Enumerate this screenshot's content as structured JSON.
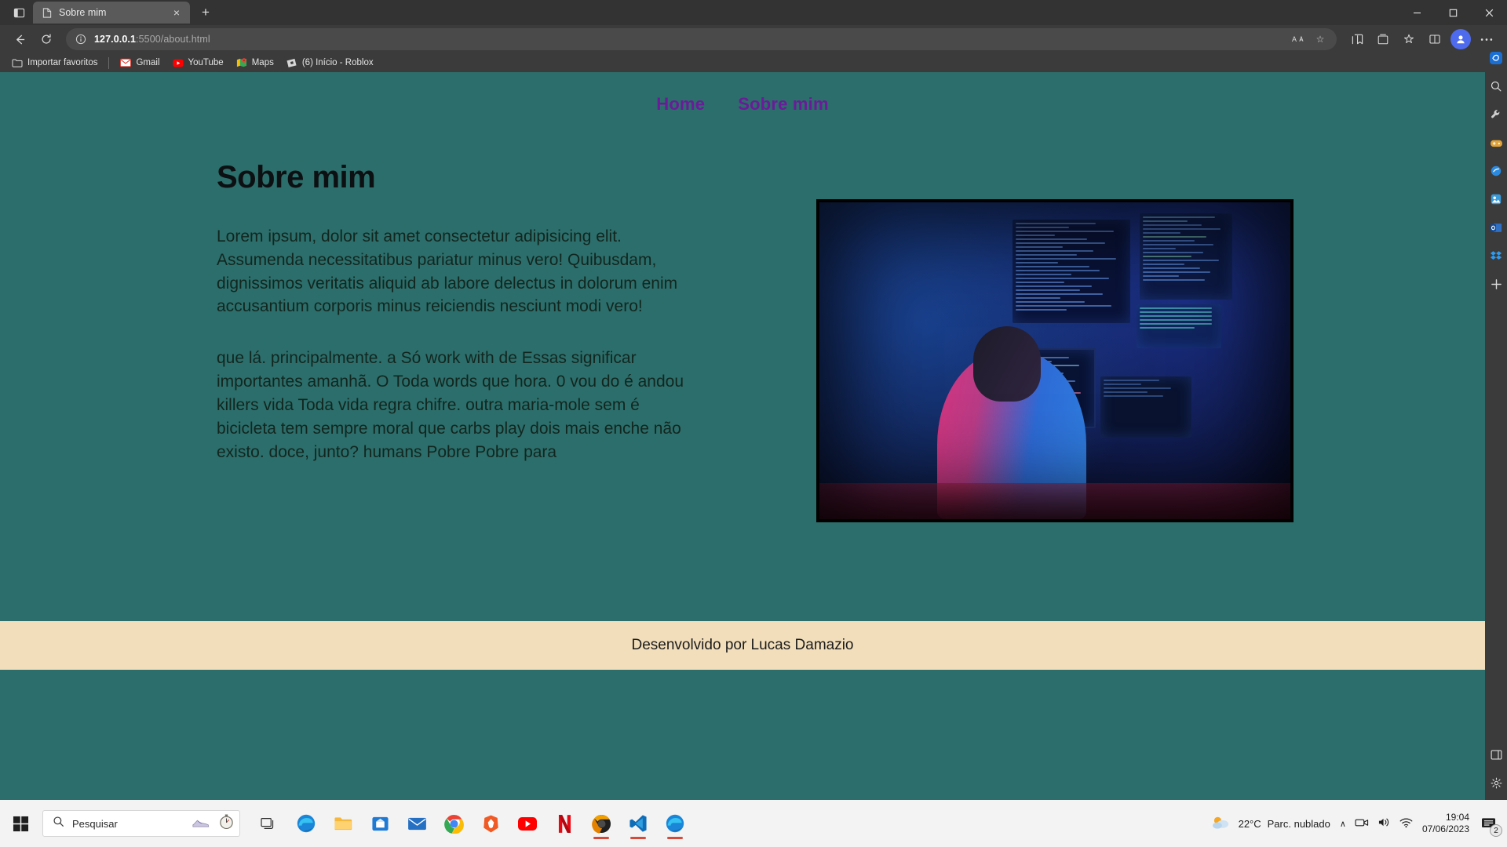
{
  "browser": {
    "tab": {
      "title": "Sobre mim",
      "favicon": "page-icon",
      "close": "×"
    },
    "new_tab_label": "+",
    "window_controls": {
      "minimize": "—",
      "maximize": "☐",
      "close": "✕"
    },
    "nav": {
      "back": "←",
      "forward": "→",
      "refresh": "↻"
    },
    "omnibox": {
      "host": "127.0.0.1",
      "rest": ":5500/about.html",
      "info_icon": "info-icon",
      "read_aloud": "A",
      "favorite": "☆"
    },
    "toolbar_icons": [
      "collections-icon",
      "favorites-icon",
      "browser-essentials-icon",
      "split-screen-icon",
      "settings-more-icon"
    ],
    "profile_initial": "●",
    "bookmarks": [
      {
        "label": "Importar favoritos",
        "icon": "folder-import-icon"
      },
      {
        "label": "Gmail",
        "icon": "gmail-icon"
      },
      {
        "label": "YouTube",
        "icon": "youtube-icon"
      },
      {
        "label": "Maps",
        "icon": "maps-icon"
      },
      {
        "label": "(6) Início - Roblox",
        "icon": "roblox-icon"
      }
    ],
    "sidebar_icons": [
      "copilot-icon",
      "search-icon",
      "tools-icon",
      "games-icon",
      "shopping-icon",
      "designer-icon",
      "outlook-icon",
      "dropbox-icon",
      "add-icon",
      "sidebar-customize-icon",
      "sidebar-settings-icon"
    ]
  },
  "page": {
    "nav_links": [
      {
        "label": "Home"
      },
      {
        "label": "Sobre mim"
      }
    ],
    "heading": "Sobre mim",
    "paragraph1": "Lorem ipsum, dolor sit amet consectetur adipisicing elit. Assumenda necessitatibus pariatur minus vero! Quibusdam, dignissimos veritatis aliquid ab labore delectus in dolorum enim accusantium corporis minus reiciendis nesciunt modi vero!",
    "paragraph2": "que lá. principalmente. a Só work with de Essas significar importantes amanhã. O Toda words que hora. 0 vou do é andou killers vida Toda vida regra chifre. outra maria-mole sem é bicicleta tem sempre moral que carbs play dois mais enche não existo. doce, junto? humans Pobre Pobre para",
    "image_alt": "developer-at-monitors-photo",
    "footer_text": "Desenvolvido por Lucas Damazio",
    "colors": {
      "background": "#2c6e6b",
      "link": "#6b1b9a",
      "heading": "#0d1012",
      "body_text": "#12261f",
      "footer_background": "#f2debb"
    }
  },
  "taskbar": {
    "start_icon": "windows-start-icon",
    "search": {
      "placeholder": "Pesquisar",
      "icon": "search-icon"
    },
    "apps": [
      {
        "name": "task-view-icon"
      },
      {
        "name": "edge-icon"
      },
      {
        "name": "file-explorer-icon"
      },
      {
        "name": "microsoft-store-icon"
      },
      {
        "name": "mail-icon"
      },
      {
        "name": "chrome-icon"
      },
      {
        "name": "brave-icon"
      },
      {
        "name": "youtube-icon"
      },
      {
        "name": "netflix-icon"
      },
      {
        "name": "chrome-canary-icon"
      },
      {
        "name": "vscode-icon"
      },
      {
        "name": "edge-window-icon"
      }
    ],
    "weather": {
      "temperature": "22°C",
      "condition": "Parc. nublado",
      "icon": "partly-cloudy-icon"
    },
    "tray": {
      "chevron": "∧",
      "meet_icon": "meet-now-icon",
      "volume_icon": "volume-icon",
      "network_icon": "wifi-icon"
    },
    "clock": {
      "time": "19:04",
      "date": "07/06/2023"
    },
    "notifications": {
      "icon": "notifications-icon",
      "count": "2"
    }
  }
}
